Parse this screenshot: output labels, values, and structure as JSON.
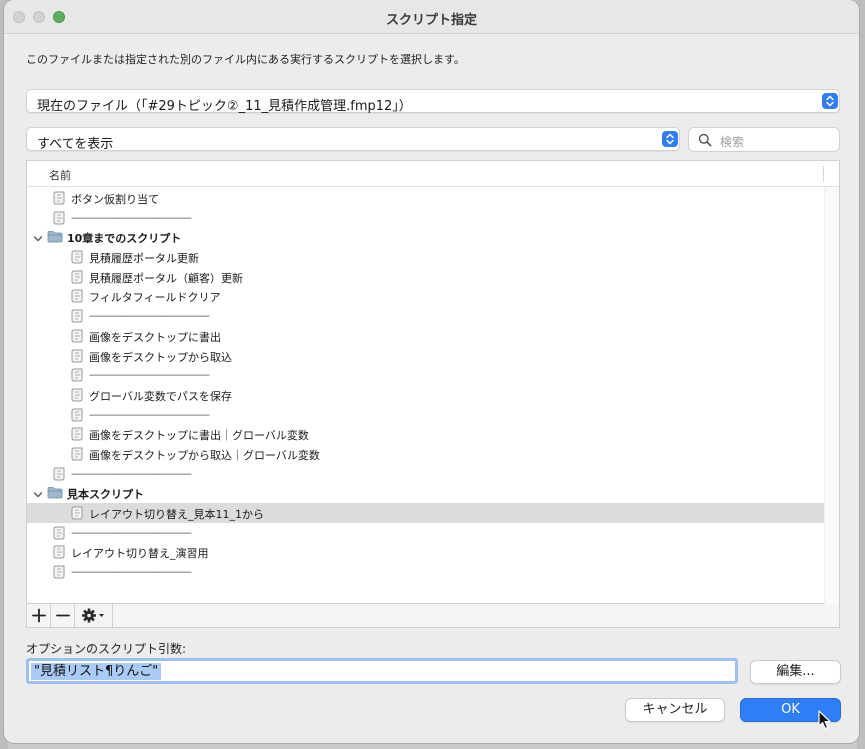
{
  "window": {
    "title": "スクリプト指定",
    "instruction": "このファイルまたは指定された別のファイル内にある実行するスクリプトを選択します。"
  },
  "file_select": {
    "value": "現在のファイル（「#29トピック②_11_見積作成管理.fmp12」）"
  },
  "show_select": {
    "value": "すべてを表示"
  },
  "search": {
    "placeholder": "検索"
  },
  "list": {
    "column_header": "名前",
    "rows": [
      {
        "type": "script",
        "indent": 0,
        "label": "ボタン仮割り当て"
      },
      {
        "type": "separator",
        "indent": 0,
        "label": "————————————"
      },
      {
        "type": "folder",
        "indent": 0,
        "label": "10章までのスクリプト",
        "expanded": true
      },
      {
        "type": "script",
        "indent": 1,
        "label": "見積履歴ポータル更新"
      },
      {
        "type": "script",
        "indent": 1,
        "label": "見積履歴ポータル（顧客）更新"
      },
      {
        "type": "script",
        "indent": 1,
        "label": "フィルタフィールドクリア"
      },
      {
        "type": "separator",
        "indent": 1,
        "label": "————————————"
      },
      {
        "type": "script",
        "indent": 1,
        "label": "画像をデスクトップに書出"
      },
      {
        "type": "script",
        "indent": 1,
        "label": "画像をデスクトップから取込"
      },
      {
        "type": "separator",
        "indent": 1,
        "label": "————————————"
      },
      {
        "type": "script",
        "indent": 1,
        "label": "グローバル変数でパスを保存"
      },
      {
        "type": "separator",
        "indent": 1,
        "label": "————————————"
      },
      {
        "type": "script",
        "indent": 1,
        "label": "画像をデスクトップに書出｜グローバル変数"
      },
      {
        "type": "script",
        "indent": 1,
        "label": "画像をデスクトップから取込｜グローバル変数"
      },
      {
        "type": "separator",
        "indent": 0,
        "label": "————————————"
      },
      {
        "type": "folder",
        "indent": 0,
        "label": "見本スクリプト",
        "expanded": true
      },
      {
        "type": "script",
        "indent": 1,
        "label": "レイアウト切り替え_見本11_1から",
        "selected": true
      },
      {
        "type": "separator",
        "indent": 0,
        "label": "————————————"
      },
      {
        "type": "script",
        "indent": 0,
        "label": "レイアウト切り替え_演習用"
      },
      {
        "type": "separator",
        "indent": 0,
        "label": "————————————"
      }
    ]
  },
  "toolbar": {
    "add_icon": "plus-icon",
    "remove_icon": "minus-icon",
    "actions_icon": "gear-icon"
  },
  "parameter": {
    "label": "オプションのスクリプト引数:",
    "value": "\"見積リスト¶りんご\""
  },
  "buttons": {
    "edit": "編集...",
    "cancel": "キャンセル",
    "ok": "OK"
  },
  "colors": {
    "accent": "#2f7ef6",
    "selected_row": "#dcdcdc",
    "selection_highlight": "#a9cbf5"
  }
}
